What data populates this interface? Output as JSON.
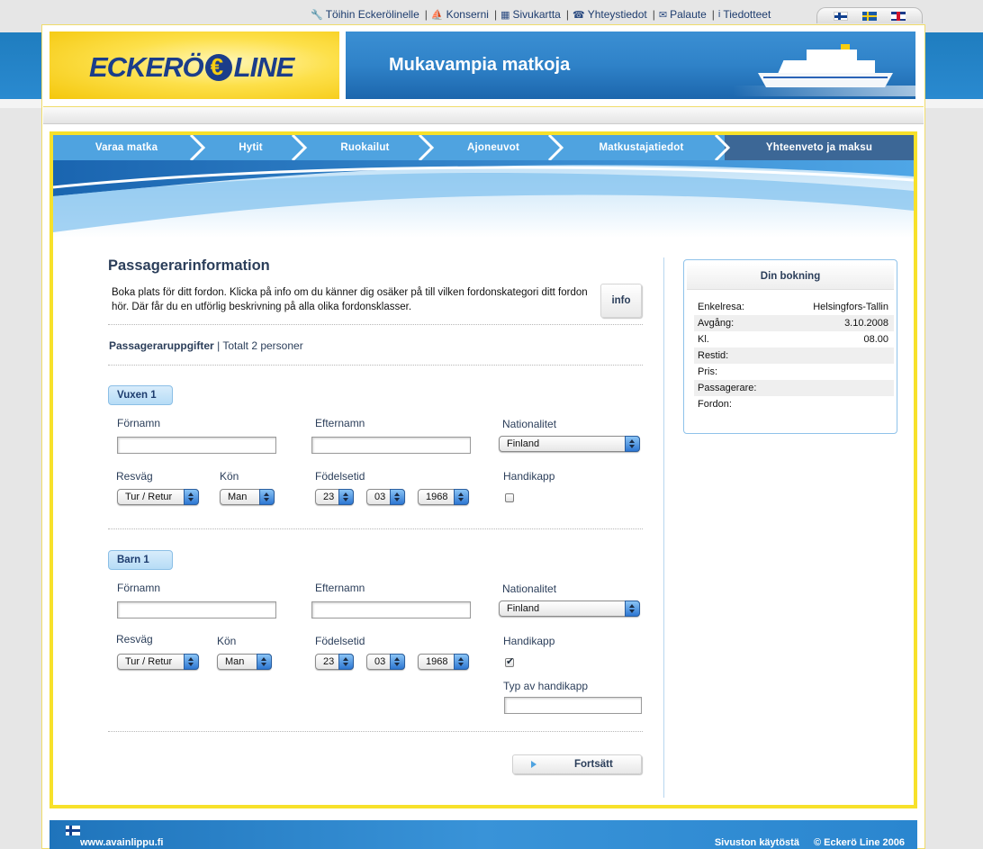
{
  "top_links": [
    {
      "label": "Töihin Eckerölinelle",
      "icon": "wrench-icon"
    },
    {
      "label": "Konserni",
      "icon": "ship-icon"
    },
    {
      "label": "Sivukartta",
      "icon": "sitemap-icon"
    },
    {
      "label": "Yhteystiedot",
      "icon": "phone-icon"
    },
    {
      "label": "Palaute",
      "icon": "envelope-icon"
    },
    {
      "label": "Tiedotteet",
      "icon": "info-icon"
    }
  ],
  "languages": [
    "finnish-flag-icon",
    "swedish-flag-icon",
    "uk-flag-icon"
  ],
  "header": {
    "logo_left": "ECKERÖ",
    "logo_right": "LINE",
    "banner_title": "Mukavampia matkoja"
  },
  "steps": [
    {
      "label": "Varaa matka",
      "state": "done"
    },
    {
      "label": "Hytit",
      "state": "done"
    },
    {
      "label": "Ruokailut",
      "state": "done"
    },
    {
      "label": "Ajoneuvot",
      "state": "done"
    },
    {
      "label": "Matkustajatiedot",
      "state": "done"
    },
    {
      "label": "Yhteenveto ja maksu",
      "state": "active"
    }
  ],
  "main": {
    "title": "Passagerarinformation",
    "intro": "Boka plats för ditt fordon. Klicka på info om du känner dig osäker på till vilken fordonskategori ditt fordon hör. Där får du en utförlig beskrivning på alla olika fordonsklasser.",
    "info_button": "info",
    "pax_heading": "Passageraruppgifter",
    "pax_separator": "|",
    "pax_total": "Totalt 2 personer",
    "continue_button": "Fortsätt"
  },
  "labels": {
    "firstname": "Förnamn",
    "lastname": "Efternamn",
    "nationality": "Nationalitet",
    "route": "Resväg",
    "gender": "Kön",
    "birthdate": "Födelsetid",
    "handicap": "Handikapp",
    "handicap_type": "Typ av handikapp"
  },
  "passengers": [
    {
      "label": "Vuxen 1",
      "firstname": "",
      "lastname": "",
      "nationality": "Finland",
      "route": "Tur / Retur",
      "gender": "Man",
      "birth_day": "23",
      "birth_month": "03",
      "birth_year": "1968",
      "handicap": false
    },
    {
      "label": "Barn 1",
      "firstname": "",
      "lastname": "",
      "nationality": "Finland",
      "route": "Tur / Retur",
      "gender": "Man",
      "birth_day": "23",
      "birth_month": "03",
      "birth_year": "1968",
      "handicap": true,
      "handicap_type": ""
    }
  ],
  "booking": {
    "title": "Din bokning",
    "rows": [
      {
        "label": "Enkelresa:",
        "value": "Helsingfors-Tallin"
      },
      {
        "label": "Avgång:",
        "value": "3.10.2008"
      },
      {
        "label": "Kl.",
        "value": "08.00"
      },
      {
        "label": "Restid:",
        "value": ""
      },
      {
        "label": "Pris:",
        "value": ""
      },
      {
        "label": "Passagerare:",
        "value": ""
      },
      {
        "label": "Fordon:",
        "value": ""
      }
    ]
  },
  "footer": {
    "url": "www.avainlippu.fi",
    "about": "Sivuston käytöstä",
    "copyright": "© Eckerö Line 2006"
  },
  "colors": {
    "step_done": "#4fa3e0",
    "step_active": "#3c6796",
    "frame_accent": "#f7e12a",
    "brand_blue": "#1b3d8a",
    "brand_yellow": "#f7cd10"
  }
}
